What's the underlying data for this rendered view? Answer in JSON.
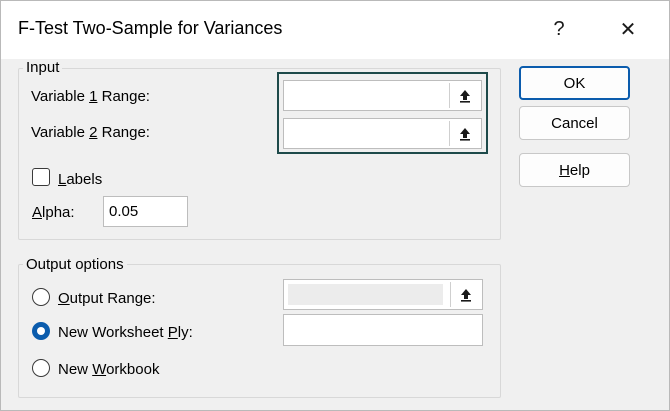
{
  "window": {
    "title": "F-Test Two-Sample for Variances",
    "help_glyph": "?",
    "close_glyph": "✕"
  },
  "input_group": {
    "label": "Input",
    "variable1": {
      "prefix": "Variable ",
      "mnemonic": "1",
      "suffix": " Range:",
      "value": ""
    },
    "variable2": {
      "prefix": "Variable ",
      "mnemonic": "2",
      "suffix": " Range:",
      "value": ""
    },
    "labels_checkbox": {
      "mnemonic": "L",
      "rest": "abels",
      "checked": false
    },
    "alpha": {
      "mnemonic": "A",
      "rest": "lpha:",
      "value": "0.05"
    }
  },
  "output_group": {
    "label": "Output options",
    "output_range": {
      "mnemonic": "O",
      "rest": "utput Range:",
      "selected": false
    },
    "new_worksheet": {
      "prefix": "New Worksheet ",
      "mnemonic": "P",
      "rest": "ly:",
      "selected": true
    },
    "new_workbook": {
      "prefix": "New ",
      "mnemonic": "W",
      "rest": "orkbook",
      "selected": false
    }
  },
  "buttons": {
    "ok": "OK",
    "cancel": "Cancel",
    "help_mnemonic": "H",
    "help_rest": "elp"
  },
  "icons": {
    "range_collapse": "range-collapse-icon"
  },
  "colors": {
    "accent": "#0b5cad",
    "focus_border": "#1e4a4a",
    "dialog_bg": "#f0f0f0"
  }
}
